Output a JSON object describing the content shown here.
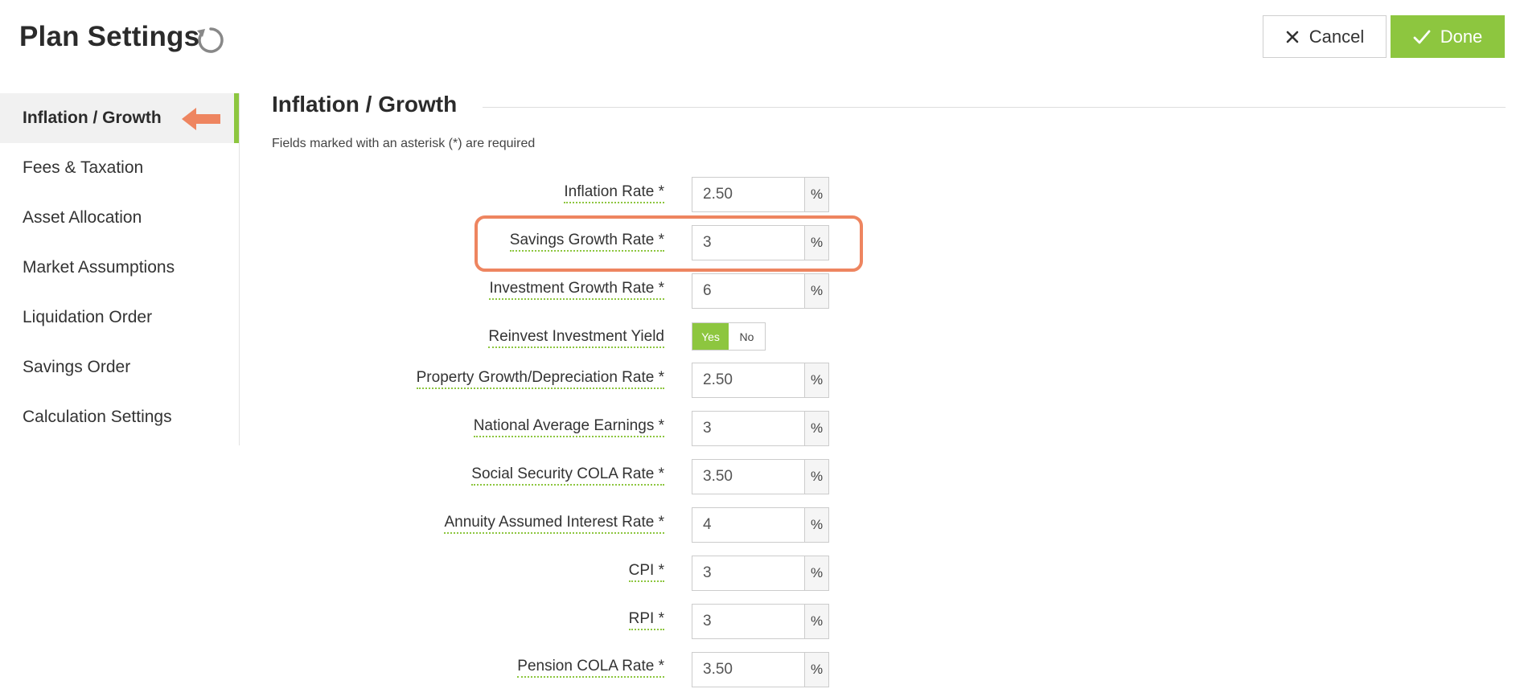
{
  "header": {
    "title": "Plan Settings",
    "cancel_label": "Cancel",
    "done_label": "Done"
  },
  "icons": {
    "refresh": "refresh-icon",
    "cancel": "close-icon",
    "done": "checkmark-icon",
    "annotation": "arrow-left-icon"
  },
  "colors": {
    "accent": "#8dc63f",
    "annotation": "#ee8560"
  },
  "sidebar": {
    "items": [
      {
        "label": "Inflation / Growth"
      },
      {
        "label": "Fees & Taxation"
      },
      {
        "label": "Asset Allocation"
      },
      {
        "label": "Market Assumptions"
      },
      {
        "label": "Liquidation Order"
      },
      {
        "label": "Savings Order"
      },
      {
        "label": "Calculation Settings"
      }
    ]
  },
  "main": {
    "section_title": "Inflation / Growth",
    "required_note": "Fields marked with an asterisk (*) are required",
    "unit": "%",
    "fields": {
      "inflation_rate": {
        "label": "Inflation Rate *",
        "value": "2.50"
      },
      "savings_growth_rate": {
        "label": "Savings Growth Rate *",
        "value": "3"
      },
      "investment_growth_rate": {
        "label": "Investment Growth Rate *",
        "value": "6"
      },
      "reinvest_investment_yield": {
        "label": "Reinvest Investment Yield",
        "yes": "Yes",
        "no": "No",
        "selected": "Yes"
      },
      "property_growth_rate": {
        "label": "Property Growth/Depreciation Rate *",
        "value": "2.50"
      },
      "national_average_earnings": {
        "label": "National Average Earnings *",
        "value": "3"
      },
      "social_security_cola_rate": {
        "label": "Social Security COLA Rate *",
        "value": "3.50"
      },
      "annuity_assumed_interest_rate": {
        "label": "Annuity Assumed Interest Rate *",
        "value": "4"
      },
      "cpi": {
        "label": "CPI *",
        "value": "3"
      },
      "rpi": {
        "label": "RPI *",
        "value": "3"
      },
      "pension_cola_rate": {
        "label": "Pension COLA Rate *",
        "value": "3.50"
      }
    }
  }
}
